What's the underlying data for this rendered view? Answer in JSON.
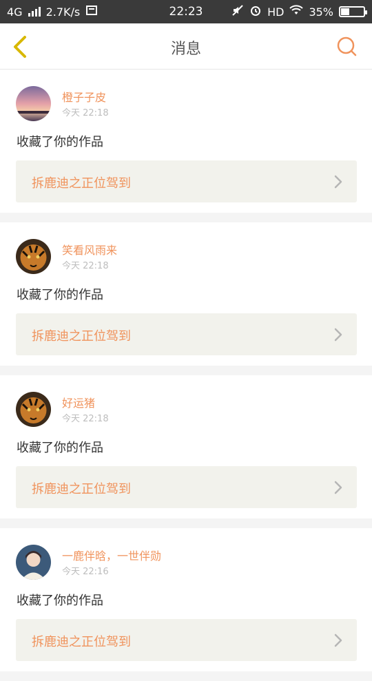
{
  "status_bar": {
    "network": "4G",
    "speed": "2.7K/s",
    "time": "22:23",
    "hd": "HD",
    "battery_percent": "35%",
    "battery_level": 0.35,
    "icons": [
      "signal-icon",
      "screenshot-icon",
      "mute-icon",
      "alarm-icon",
      "wifi-icon",
      "battery-icon"
    ]
  },
  "header": {
    "title": "消息",
    "back_icon": "chevron-left-icon",
    "search_icon": "search-icon",
    "accent_color": "#f0935c",
    "back_color": "#d8b800"
  },
  "messages": [
    {
      "username": "橙子子皮",
      "time": "今天 22:18",
      "action": "收藏了你的作品",
      "work_title": "拆鹿迪之正位驾到",
      "avatar": "sunset"
    },
    {
      "username": "笑看风雨来",
      "time": "今天 22:18",
      "action": "收藏了你的作品",
      "work_title": "拆鹿迪之正位驾到",
      "avatar": "tiger"
    },
    {
      "username": "好运猪",
      "time": "今天 22:18",
      "action": "收藏了你的作品",
      "work_title": "拆鹿迪之正位驾到",
      "avatar": "tiger"
    },
    {
      "username": "一鹿伴晗，一世伴勋",
      "time": "今天 22:16",
      "action": "收藏了你的作品",
      "work_title": "拆鹿迪之正位驾到",
      "avatar": "person"
    }
  ]
}
